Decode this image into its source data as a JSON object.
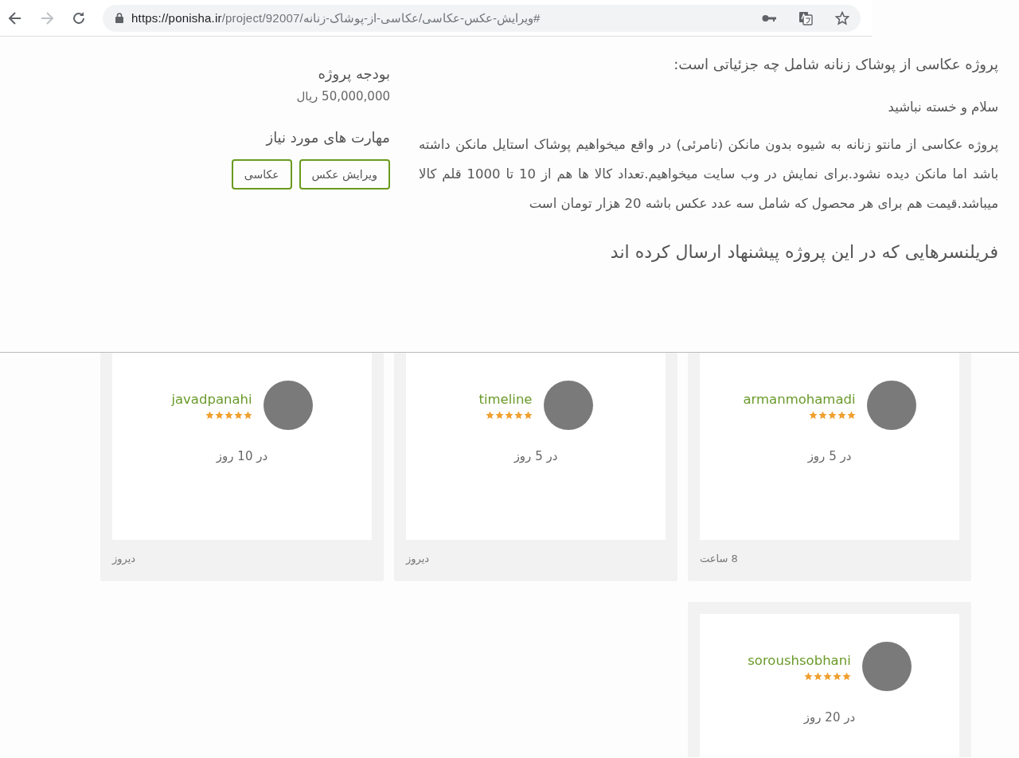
{
  "browser": {
    "url_host": "https://ponisha.ir",
    "url_path": "/project/92007/ویرایش-عکس-عکاسی/عکاسی-از-پوشاک-زنانه#"
  },
  "project": {
    "details_title": "پروژه عکاسی از پوشاک زنانه شامل چه جزئیاتی است:",
    "greeting": "سلام و خسته نباشید",
    "description": "پروژه عکاسی از مانتو زنانه به شیوه بدون مانکن (نامرئی) در واقع میخواهیم پوشاک استایل مانکن داشته باشد اما مانکن دیده نشود.برای نمایش در وب سایت میخواهیم.تعداد کالا ها هم از 10 تا 1000 قلم کالا میباشد.قیمت هم برای هر محصول که شامل سه عدد عکس باشه 20 هزار تومان است",
    "budget_title": "بودجه پروژه",
    "budget": "50,000,000 ریال",
    "skills_title": "مهارت های مورد نیاز",
    "skills": [
      "ویرایش عکس",
      "عکاسی"
    ]
  },
  "bids_title": "فریلنسرهایی که در این پروژه پیشنهاد ارسال کرده اند",
  "bids": [
    {
      "username": "armanmohamadi",
      "stars": 5,
      "delivery": "در 5 روز",
      "posted": "8 ساعت"
    },
    {
      "username": "timeline",
      "stars": 5,
      "delivery": "در 5 روز",
      "posted": "دیروز"
    },
    {
      "username": "javadpanahi",
      "stars": 5,
      "delivery": "در 10 روز",
      "posted": "دیروز"
    },
    {
      "username": "soroushsobhani",
      "stars": 5,
      "delivery": "در 20 روز"
    }
  ]
}
